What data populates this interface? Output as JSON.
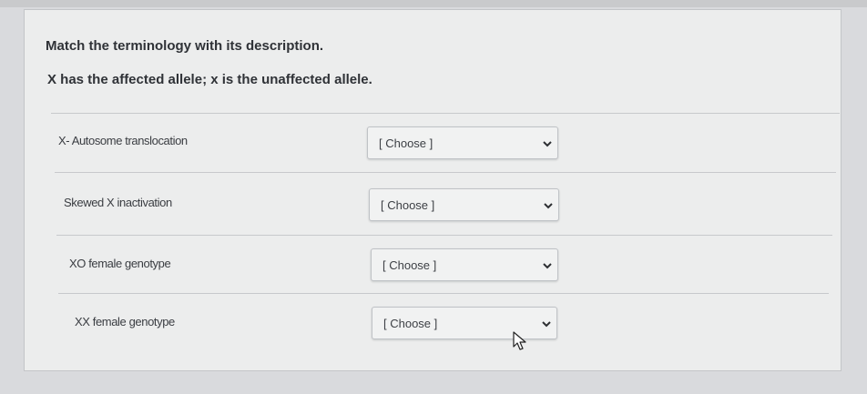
{
  "quiz": {
    "question": "Match the terminology with its description.",
    "prompt": "X has the affected allele; x is the unaffected allele."
  },
  "rows": [
    {
      "term": "X- Autosome translocation",
      "select_value": "[ Choose ]"
    },
    {
      "term": "Skewed X inactivation",
      "select_value": "[ Choose ]"
    },
    {
      "term": "XO female genotype",
      "select_value": "[ Choose ]"
    },
    {
      "term": "XX female genotype",
      "select_value": "[ Choose ]"
    }
  ],
  "icons": {
    "dropdown": "chevron-down-icon",
    "pointer": "mouse-cursor-icon"
  },
  "colors": {
    "background": "#d9dadd",
    "card": "#eceded",
    "text": "#2f3237"
  }
}
